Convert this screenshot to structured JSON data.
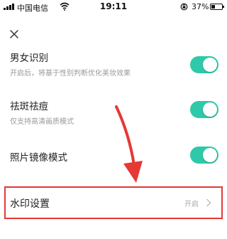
{
  "status_bar": {
    "carrier": "中国电信",
    "time": "19:11",
    "battery_percent": "37%",
    "battery_level": 0.37
  },
  "header": {
    "close_icon": "close-icon"
  },
  "settings": [
    {
      "title": "男女识别",
      "subtitle": "开启后，将基于性别判断优化美妆效果",
      "enabled": true
    },
    {
      "title": "祛斑祛痘",
      "subtitle": "仅支持高清画质模式",
      "enabled": true
    },
    {
      "title": "照片镜像模式",
      "subtitle": "",
      "enabled": true
    }
  ],
  "watermark": {
    "title": "水印设置",
    "value": "开启",
    "chevron_icon": "chevron-right-icon"
  },
  "colors": {
    "accent": "#2dc9a9",
    "annotation": "#e53935"
  }
}
